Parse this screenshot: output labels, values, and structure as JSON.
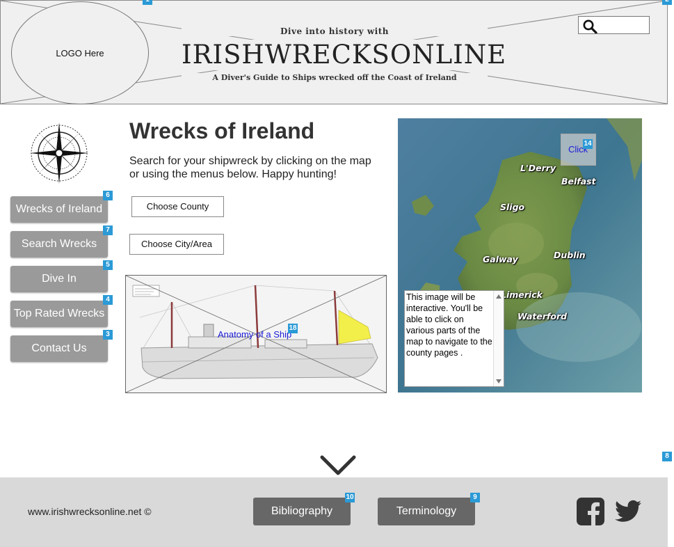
{
  "header": {
    "logo_text": "LOGO Here",
    "tagline_top": "Dive into history with",
    "brand": "IRISHWRECKSONLINE",
    "tagline_bottom": "A Diver's Guide to Ships wrecked off the Coast of Ireland",
    "search": {
      "icon": "search-icon",
      "value": ""
    }
  },
  "sidebar": {
    "nav": [
      {
        "label": "Wrecks of Ireland",
        "badge": "6"
      },
      {
        "label": "Search Wrecks",
        "badge": "7"
      },
      {
        "label": "Dive In",
        "badge": "5"
      },
      {
        "label": "Top Rated Wrecks",
        "badge": "4"
      },
      {
        "label": "Contact Us",
        "badge": "3"
      }
    ]
  },
  "main": {
    "title": "Wrecks of Ireland",
    "intro": "Search for your shipwreck by clicking on the map or using the menus below. Happy hunting!",
    "choose_county": "Choose County",
    "choose_city": "Choose City/Area",
    "ship_link": "Anatomy of a Ship",
    "ship_badge": "18"
  },
  "map": {
    "click_label": "Click",
    "click_badge": "14",
    "cities": [
      "L'Derry",
      "Belfast",
      "Sligo",
      "Dublin",
      "Galway",
      "Limerick",
      "Waterford"
    ],
    "note": "This image will be interactive.  You'll be able to click on various parts of the map to navigate to the county pages ."
  },
  "badges": {
    "logo": "1",
    "search": "2",
    "page": "8"
  },
  "footer": {
    "copyright": "www.irishwrecksonline.net ©",
    "bibliography": "Bibliography",
    "bibliography_badge": "10",
    "terminology": "Terminology",
    "terminology_badge": "9",
    "social": [
      "facebook-icon",
      "twitter-icon"
    ]
  },
  "colors": {
    "header_bg": "#f0f0f0",
    "nav_button": "#9a9a9a",
    "footer_bg": "#d9d9d9",
    "footer_button": "#676767",
    "badge": "#2b9ad6",
    "link": "#1a1ad6"
  }
}
